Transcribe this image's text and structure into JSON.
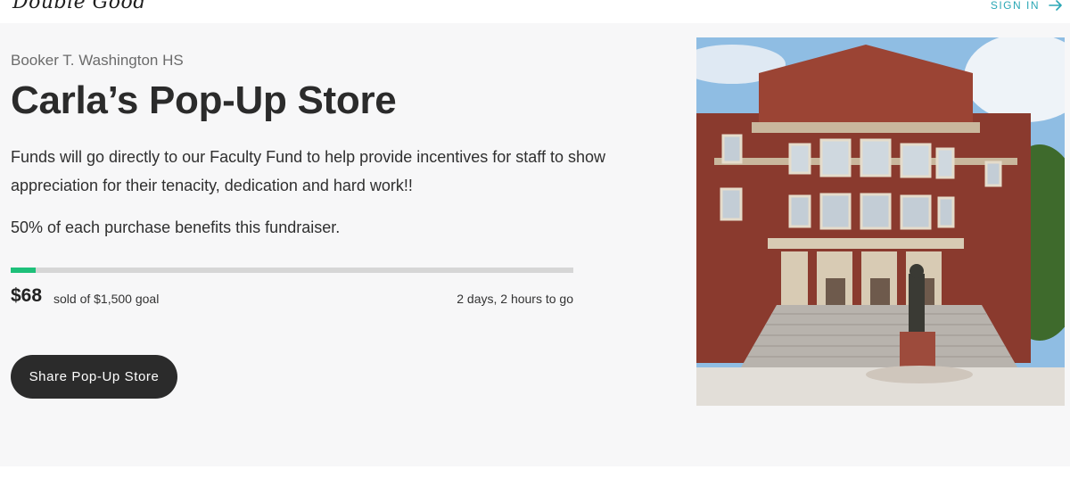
{
  "header": {
    "logo_text": "Double Good",
    "signin_label": "SIGN IN",
    "signin_icon": "arrow-right-icon"
  },
  "store": {
    "school": "Booker T. Washington HS",
    "title": "Carla’s Pop-Up Store",
    "description": "Funds will go directly to our Faculty Fund to help provide incentives for staff to show appreciation for their tenacity, dedication and hard work!!",
    "benefit": "50% of each purchase benefits this fundraiser.",
    "progress": {
      "fraction": 0.045,
      "sold": "$68",
      "sold_label": "sold of $1,500 goal",
      "time_left": "2 days, 2 hours to go"
    },
    "share_label": "Share Pop-Up Store",
    "image": "school-building-photo"
  },
  "colors": {
    "accent": "#2aa7b5",
    "progress_fill": "#1ec07a",
    "progress_track": "#d6d6d6",
    "button_bg": "#2b2b2b",
    "hero_bg": "#f7f7f8"
  }
}
